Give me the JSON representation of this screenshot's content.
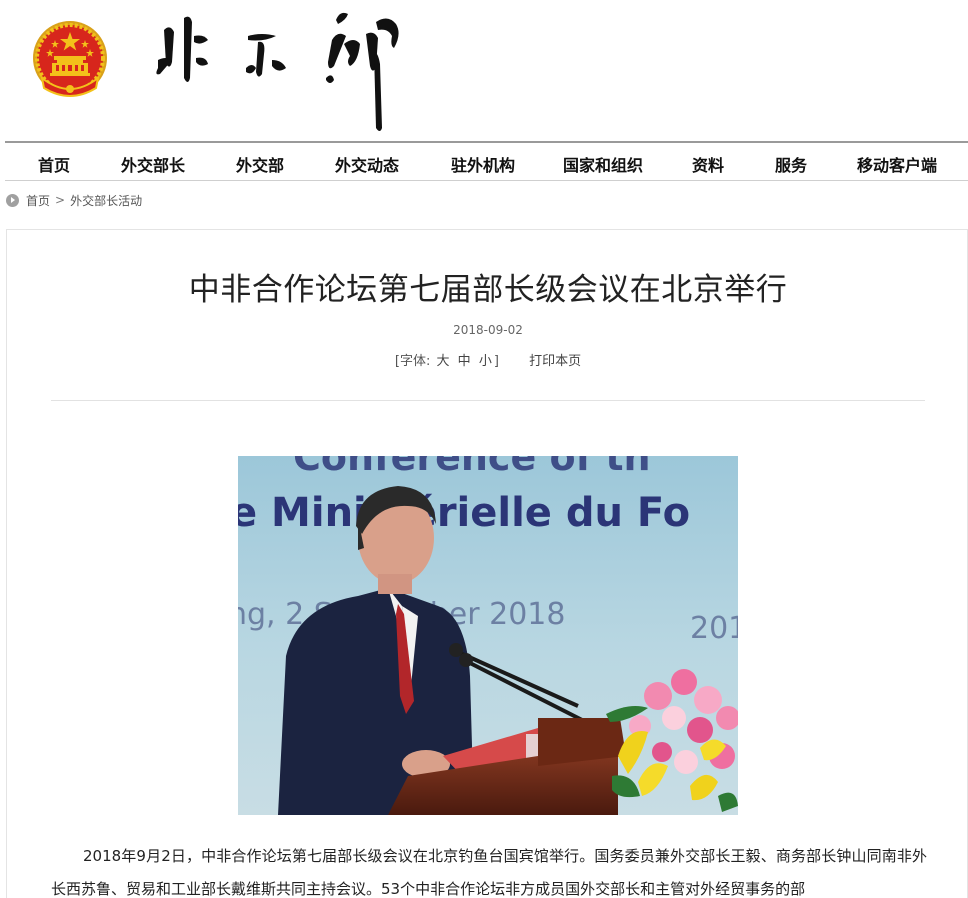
{
  "header": {
    "logo_name": "national-emblem-icon",
    "wordmark": "外交部"
  },
  "nav": {
    "items": [
      {
        "label": "首页"
      },
      {
        "label": "外交部长"
      },
      {
        "label": "外交部"
      },
      {
        "label": "外交动态"
      },
      {
        "label": "驻外机构"
      },
      {
        "label": "国家和组织"
      },
      {
        "label": "资料"
      },
      {
        "label": "服务"
      },
      {
        "label": "移动客户端"
      }
    ]
  },
  "breadcrumb": {
    "home": "首页",
    "separator": ">",
    "current": "外交部长活动"
  },
  "article": {
    "title": "中非合作论坛第七届部长级会议在北京举行",
    "date": "2018-09-02",
    "font_prefix": "[字体:",
    "font_large": "大",
    "font_medium": "中",
    "font_small": "小",
    "font_suffix": "]",
    "print": "打印本页",
    "photo_banner_line1": "Conférence of th",
    "photo_banner_line2": "e Ministérielle du Fo",
    "photo_banner_line3": "ng, 2 September 2018",
    "photo_banner_line4": "201",
    "paragraph": "2018年9月2日，中非合作论坛第七届部长级会议在北京钓鱼台国宾馆举行。国务委员兼外交部长王毅、商务部长钟山同南非外长西苏鲁、贸易和工业部长戴维斯共同主持会议。53个中非合作论坛非方成员国外交部长和主管对外经贸事务的部"
  },
  "colors": {
    "nav_border": "#9a9a9a",
    "emblem_red": "#d7261c",
    "emblem_gold": "#f3c11a"
  }
}
